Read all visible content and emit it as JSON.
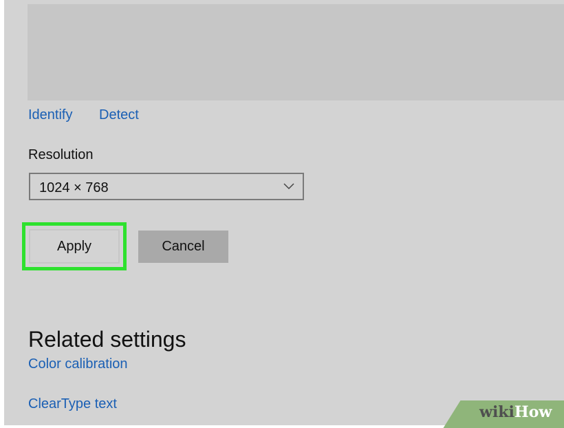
{
  "display": {
    "identify_label": "Identify",
    "detect_label": "Detect"
  },
  "resolution": {
    "label": "Resolution",
    "selected_value": "1024 × 768",
    "dropdown_icon": "chevron-down-icon"
  },
  "actions": {
    "apply_label": "Apply",
    "cancel_label": "Cancel",
    "highlight_color": "#2ee12e"
  },
  "related_settings": {
    "title": "Related settings",
    "links": [
      {
        "label": "Color calibration"
      },
      {
        "label": "ClearType text"
      }
    ]
  },
  "watermark": {
    "part1": "wiki",
    "part2": "How"
  },
  "colors": {
    "background": "#d3d3d3",
    "link": "#1a5fb4",
    "cancel_button": "#a9a9a9"
  }
}
